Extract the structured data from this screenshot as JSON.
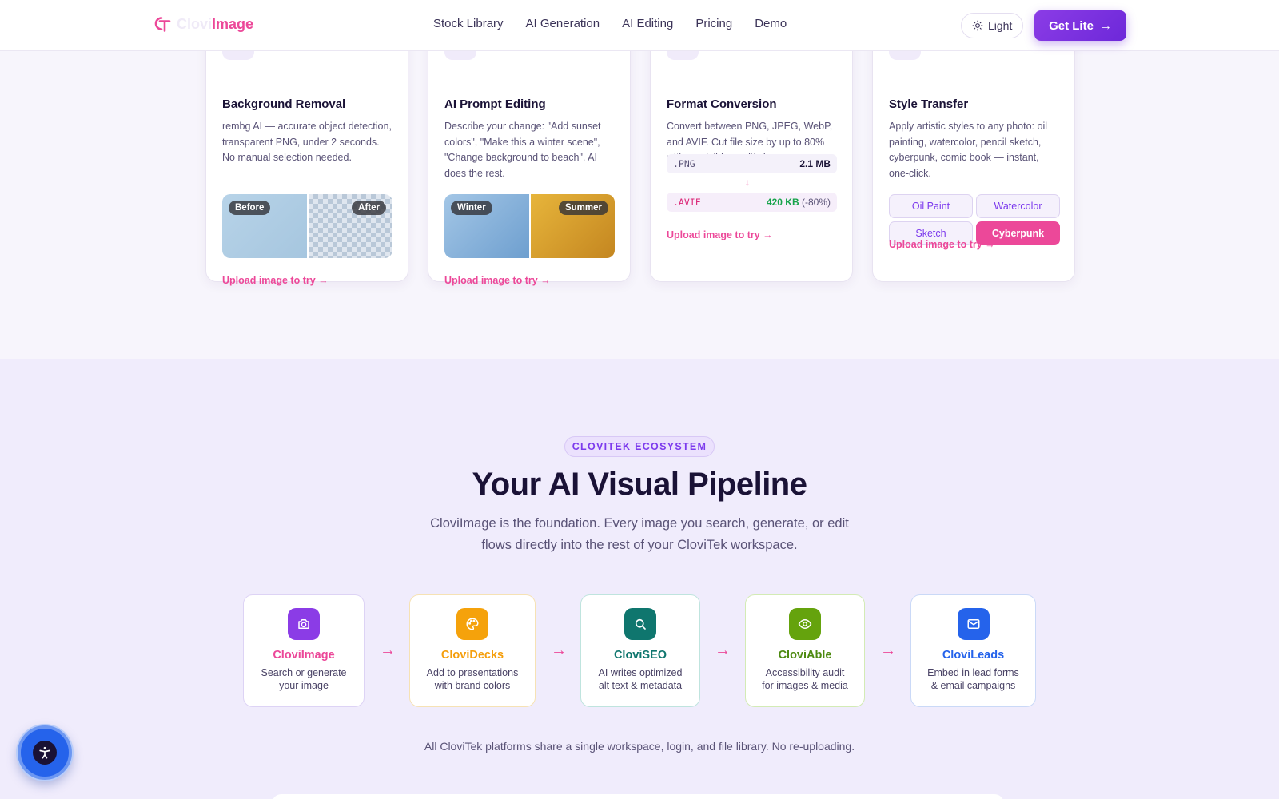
{
  "header": {
    "logo_part1": "Clovi",
    "logo_part2": "Image",
    "nav": [
      "Stock Library",
      "AI Generation",
      "AI Editing",
      "Pricing",
      "Demo"
    ],
    "theme_label": "Light",
    "cta_label": "Get Lite"
  },
  "tools": [
    {
      "title": "Background Removal",
      "desc": "rembg AI — accurate object detection, transparent PNG, under 2 seconds. No manual selection needed.",
      "left_label": "Before",
      "right_label": "After",
      "try_label": "Upload image to try"
    },
    {
      "title": "AI Prompt Editing",
      "desc": "Describe your change: \"Add sunset colors\", \"Make this a winter scene\", \"Change background to beach\". AI does the rest.",
      "left_label": "Winter",
      "right_label": "Summer",
      "try_label": "Upload image to try"
    },
    {
      "title": "Format Conversion",
      "desc": "Convert between PNG, JPEG, WebP, and AVIF. Cut file size by up to 80% with no visible quality loss.",
      "input_ext": ".PNG",
      "input_size": "2.1 MB",
      "output_ext": ".AVIF",
      "output_size": "420 KB",
      "output_pct": "(-80%)",
      "try_label": "Upload image to try"
    },
    {
      "title": "Style Transfer",
      "desc": "Apply artistic styles to any photo: oil painting, watercolor, pencil sketch, cyberpunk, comic book — instant, one-click.",
      "styles": [
        "Oil Paint",
        "Watercolor",
        "Sketch",
        "Cyberpunk"
      ],
      "active_style": "Cyberpunk",
      "try_label": "Upload image to try"
    }
  ],
  "ecosystem": {
    "eyebrow": "CLOVITEK ECOSYSTEM",
    "title": "Your AI Visual Pipeline",
    "subtitle": "CloviImage is the foundation. Every image you search, generate, or edit flows directly into the rest of your CloviTek workspace.",
    "steps": [
      {
        "name": "CloviImage",
        "line1": "Search or generate",
        "line2": "your image",
        "color": "#ec4899",
        "icon_bg": "#8b3ce6",
        "icon": "camera-icon"
      },
      {
        "name": "CloviDecks",
        "line1": "Add to presentations",
        "line2": "with brand colors",
        "color": "#f59e0b",
        "icon_bg": "#f5a20b",
        "icon": "palette-icon"
      },
      {
        "name": "CloviSEO",
        "line1": "AI writes optimized",
        "line2": "alt text & metadata",
        "color": "#0f766e",
        "icon_bg": "#0f766e",
        "icon": "search-icon"
      },
      {
        "name": "CloviAble",
        "line1": "Accessibility audit",
        "line2": "for images & media",
        "color": "#4d8a10",
        "icon_bg": "#65a30d",
        "icon": "eye-icon"
      },
      {
        "name": "CloviLeads",
        "line1": "Embed in lead forms",
        "line2": "& email campaigns",
        "color": "#2563eb",
        "icon_bg": "#2563eb",
        "icon": "mail-icon"
      }
    ],
    "footer": "All CloviTek platforms share a single workspace, login, and file library. No re-uploading."
  }
}
